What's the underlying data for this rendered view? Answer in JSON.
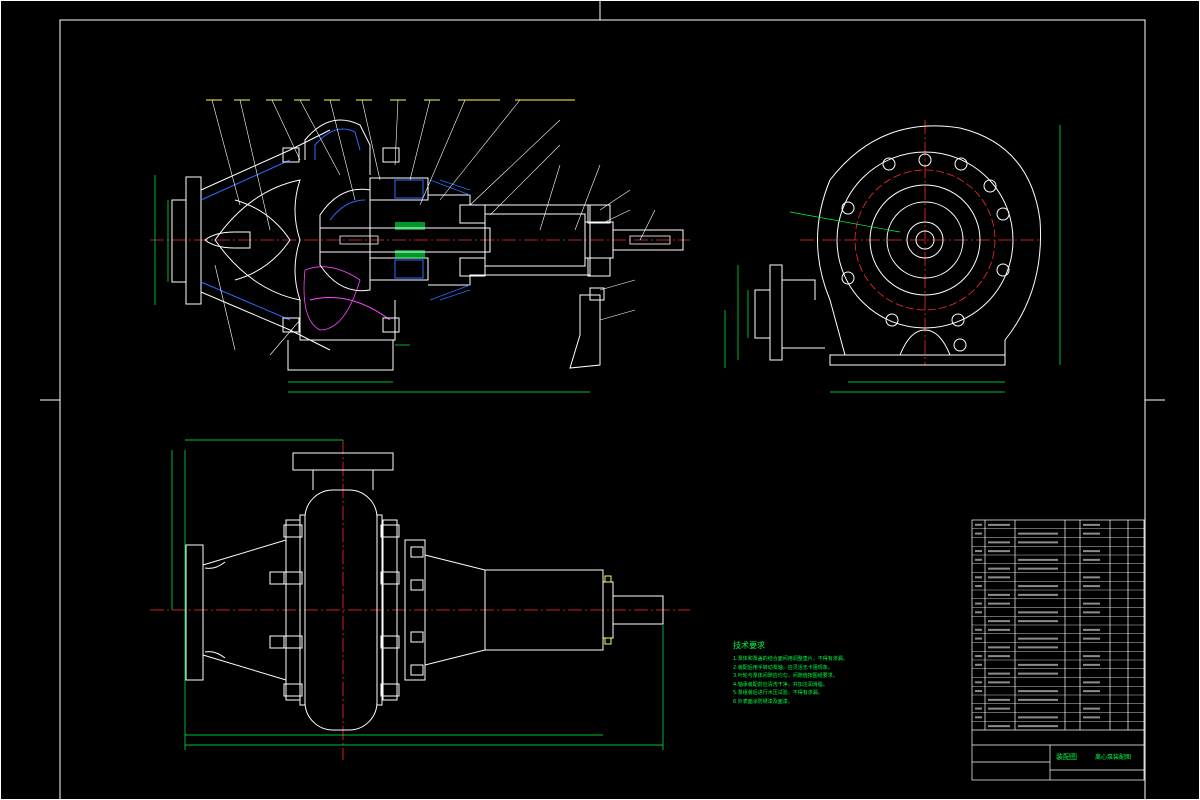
{
  "drawing": {
    "background": "#000000",
    "colors": {
      "outline": "#ffffff",
      "dimension": "#00ff44",
      "centerline": "#ff2a2a",
      "hatch": "#2a6bff",
      "detail": "#ff44ff",
      "highlight": "#ffff44",
      "cyan": "#44ffff"
    }
  },
  "technical_requirements": {
    "title": "技术要求",
    "items": [
      "1.泵体和泵盖的结合面间用调整垫片，不得有渗漏。",
      "2.装配后用手转动泵轴，应灵活无卡阻现象。",
      "3.叶轮与泵体间隙应均匀，间隙值按图纸要求。",
      "4.轴承装配前应清洗干净，并加注润滑脂。",
      "5.泵组装后进行水压试验，不得有渗漏。",
      "6.外表面涂防锈漆及面漆。"
    ]
  },
  "title_block": {
    "name": "装配图",
    "company": "离心泵装配图"
  }
}
